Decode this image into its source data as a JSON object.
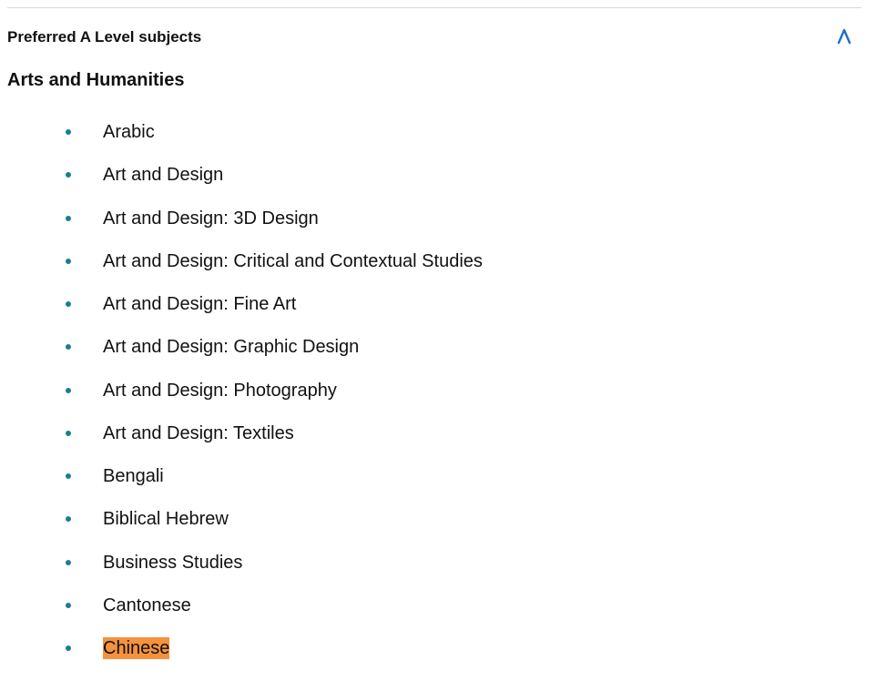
{
  "accordion": {
    "title": "Preferred A Level subjects",
    "expanded": true,
    "toggle_icon": "chevron-up-icon",
    "toggle_color": "#1f6fc5"
  },
  "section": {
    "heading": "Arts and Humanities"
  },
  "colors": {
    "bullet": "#1a7f8c",
    "highlight": "#f5923e",
    "divider": "#d9d9d9"
  },
  "subjects": [
    {
      "label": "Arabic"
    },
    {
      "label": "Art and Design"
    },
    {
      "label": "Art and Design: 3D Design"
    },
    {
      "label": "Art and Design: Critical and Contextual Studies"
    },
    {
      "label": "Art and Design: Fine Art"
    },
    {
      "label": "Art and Design: Graphic Design"
    },
    {
      "label": "Art and Design: Photography"
    },
    {
      "label": "Art and Design: Textiles"
    },
    {
      "label": "Bengali"
    },
    {
      "label": "Biblical Hebrew"
    },
    {
      "label": "Business Studies"
    },
    {
      "label": "Cantonese"
    },
    {
      "label": "Chinese",
      "highlighted": true
    }
  ]
}
